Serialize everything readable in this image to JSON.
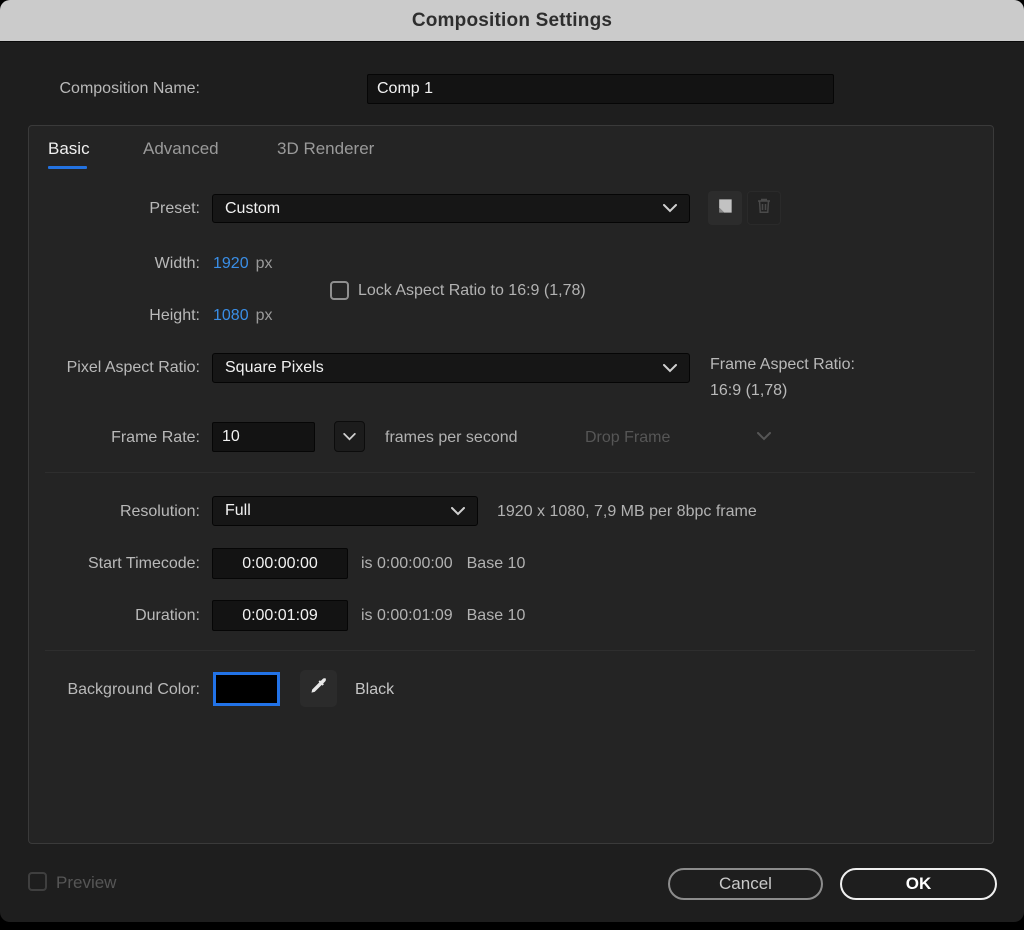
{
  "window": {
    "title": "Composition Settings"
  },
  "composition_name": {
    "label": "Composition Name:",
    "value": "Comp 1"
  },
  "tabs": [
    {
      "label": "Basic"
    },
    {
      "label": "Advanced"
    },
    {
      "label": "3D Renderer"
    }
  ],
  "preset": {
    "label": "Preset:",
    "value": "Custom"
  },
  "dimensions": {
    "width_label": "Width:",
    "width_value": "1920",
    "width_unit": "px",
    "height_label": "Height:",
    "height_value": "1080",
    "height_unit": "px",
    "lock_label": "Lock Aspect Ratio to 16:9 (1,78)"
  },
  "pixel_aspect": {
    "label": "Pixel Aspect Ratio:",
    "value": "Square Pixels",
    "frame_aspect_label": "Frame Aspect Ratio:",
    "frame_aspect_value": "16:9 (1,78)"
  },
  "frame_rate": {
    "label": "Frame Rate:",
    "value": "10",
    "unit": "frames per second",
    "drop_frame_label": "Drop Frame"
  },
  "resolution": {
    "label": "Resolution:",
    "value": "Full",
    "info": "1920 x 1080, 7,9 MB per 8bpc frame"
  },
  "start_timecode": {
    "label": "Start Timecode:",
    "value": "0:00:00:00",
    "is_text": "is 0:00:00:00",
    "base_text": "Base 10"
  },
  "duration": {
    "label": "Duration:",
    "value": "0:00:01:09",
    "is_text": "is 0:00:01:09",
    "base_text": "Base 10"
  },
  "background_color": {
    "label": "Background Color:",
    "swatch_color": "#000000",
    "color_name": "Black"
  },
  "footer": {
    "preview_label": "Preview",
    "cancel_label": "Cancel",
    "ok_label": "OK"
  },
  "colors": {
    "accent_blue": "#2372e0",
    "hot_text_blue": "#3a8ee6",
    "titlebar_bg": "#cbcbcb",
    "panel_bg": "#242424"
  }
}
